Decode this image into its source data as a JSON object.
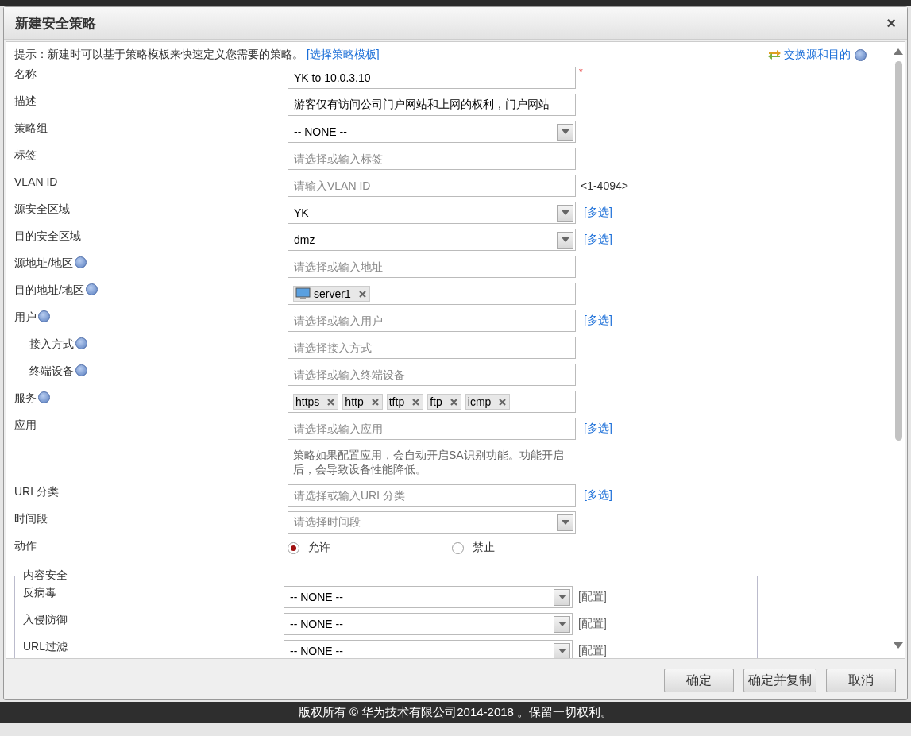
{
  "dialog": {
    "title": "新建安全策略",
    "close": "×"
  },
  "hint": {
    "text": "提示：新建时可以基于策略模板来快速定义您需要的策略。",
    "link": "[选择策略模板]",
    "swap_link": "交换源和目的"
  },
  "fields": [
    {
      "label": "名称",
      "kind": "input",
      "value": "YK to 10.0.3.10",
      "required_mark": "*"
    },
    {
      "label": "描述",
      "kind": "input",
      "value": "游客仅有访问公司门户网站和上网的权利，门户网站"
    },
    {
      "label": "策略组",
      "kind": "select",
      "value": "-- NONE --"
    },
    {
      "label": "标签",
      "kind": "input",
      "placeholder": "请选择或输入标签"
    },
    {
      "label": "VLAN ID",
      "kind": "input",
      "placeholder": "请输入VLAN ID",
      "suffix": "<1-4094>"
    },
    {
      "label": "源安全区域",
      "kind": "select",
      "value": "YK",
      "link": "[多选]"
    },
    {
      "label": "目的安全区域",
      "kind": "select",
      "value": "dmz",
      "link": "[多选]"
    },
    {
      "label": "源地址/地区",
      "help": true,
      "kind": "input",
      "placeholder": "请选择或输入地址"
    },
    {
      "label": "目的地址/地区",
      "help": true,
      "kind": "tags",
      "tags": [
        {
          "text": "server1",
          "icon": true
        }
      ]
    },
    {
      "label": "用户",
      "help": true,
      "kind": "input",
      "placeholder": "请选择或输入用户",
      "link": "[多选]"
    },
    {
      "label": "接入方式",
      "help": true,
      "indented": true,
      "kind": "input",
      "placeholder": "请选择接入方式"
    },
    {
      "label": "终端设备",
      "help": true,
      "indented": true,
      "kind": "input",
      "placeholder": "请选择或输入终端设备"
    },
    {
      "label": "服务",
      "help": true,
      "kind": "tags",
      "tags": [
        {
          "text": "https"
        },
        {
          "text": "http"
        },
        {
          "text": "tftp"
        },
        {
          "text": "ftp"
        },
        {
          "text": "icmp"
        }
      ]
    },
    {
      "label": "应用",
      "kind": "input",
      "placeholder": "请选择或输入应用",
      "link": "[多选]",
      "note": "策略如果配置应用，会自动开启SA识别功能。功能开启后，会导致设备性能降低。"
    },
    {
      "label": "URL分类",
      "kind": "input",
      "placeholder": "请选择或输入URL分类",
      "link": "[多选]"
    },
    {
      "label": "时间段",
      "kind": "select",
      "placeholder": "请选择时间段"
    },
    {
      "label": "动作",
      "kind": "radio",
      "options": [
        {
          "text": "允许",
          "selected": true
        },
        {
          "text": "禁止",
          "selected": false
        }
      ]
    }
  ],
  "content_security": {
    "legend": "内容安全",
    "rows": [
      {
        "label": "反病毒",
        "value": "-- NONE --",
        "link": "[配置]"
      },
      {
        "label": "入侵防御",
        "value": "-- NONE --",
        "link": "[配置]"
      },
      {
        "label": "URL过滤",
        "value": "-- NONE --",
        "link": "[配置]"
      }
    ]
  },
  "buttons": [
    "确定",
    "确定并复制",
    "取消"
  ],
  "footer": "版权所有 © 华为技术有限公司2014-2018 。保留一切权利。"
}
